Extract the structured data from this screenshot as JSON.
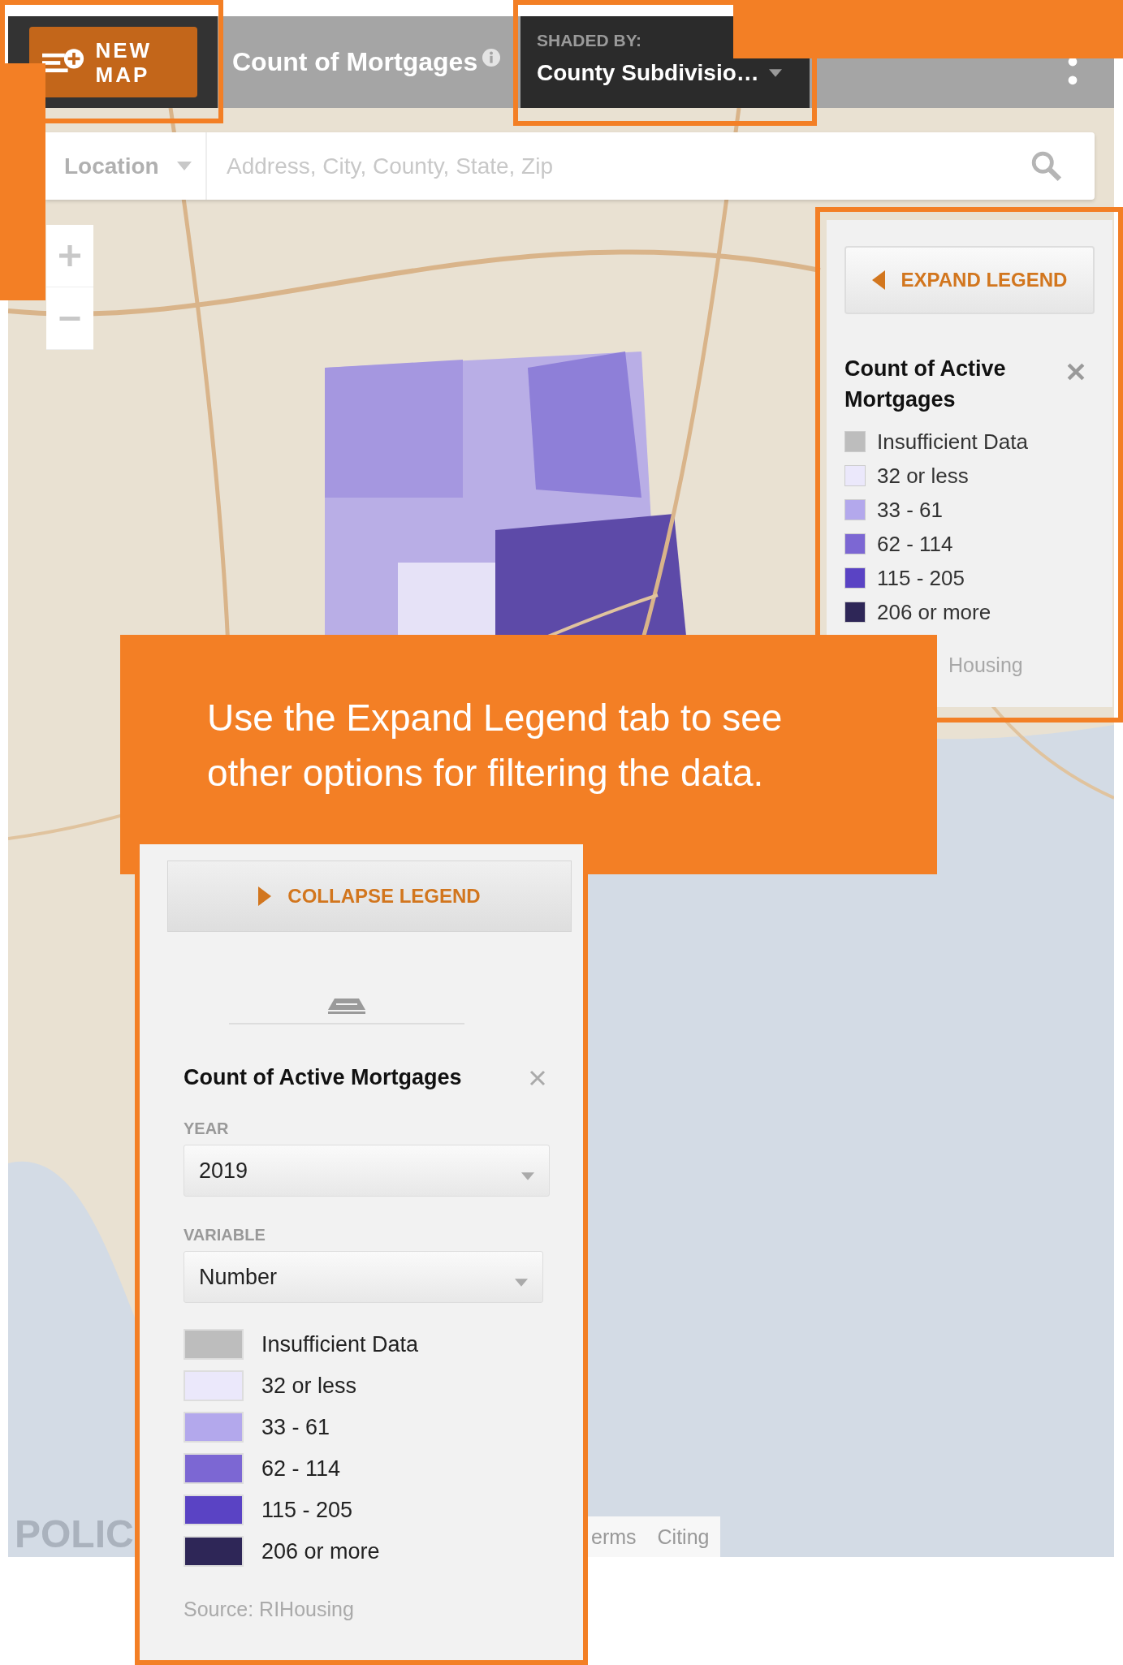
{
  "header": {
    "new_map_button": "NEW MAP",
    "map_title": "Count of Mortgages",
    "shaded_by": {
      "label": "SHADED BY:",
      "value": "County Subdivisio…"
    }
  },
  "search": {
    "location": "Location",
    "placeholder": "Address, City, County, State, Zip"
  },
  "legend_collapsed": {
    "expand_button": "EXPAND LEGEND",
    "title": "Count of Active Mortgages",
    "items": [
      {
        "label": "Insufficient Data",
        "color": "#bdbdbd"
      },
      {
        "label": "32 or less",
        "color": "#ebe8fb"
      },
      {
        "label": "33 - 61",
        "color": "#b3a8ec"
      },
      {
        "label": "62 - 114",
        "color": "#7c67d3"
      },
      {
        "label": "115 - 205",
        "color": "#5a43c4"
      },
      {
        "label": "206 or more",
        "color": "#2e2657"
      }
    ],
    "source": "Housing"
  },
  "callout": "Use the Expand Legend tab to see other options for filtering the data.",
  "legend_expanded": {
    "collapse_button": "COLLAPSE LEGEND",
    "title": "Count of Active Mortgages",
    "fields": [
      {
        "label": "YEAR",
        "value": "2019"
      },
      {
        "label": "VARIABLE",
        "value": "Number"
      }
    ],
    "items": [
      {
        "label": "Insufficient Data",
        "color": "#bdbdbd"
      },
      {
        "label": "32 or less",
        "color": "#ebe8fb"
      },
      {
        "label": "33 - 61",
        "color": "#b3a8ec"
      },
      {
        "label": "62 - 114",
        "color": "#7c67d3"
      },
      {
        "label": "115 - 205",
        "color": "#5a43c4"
      },
      {
        "label": "206 or more",
        "color": "#2e2657"
      }
    ],
    "source": "Source: RIHousing"
  },
  "map_footer": {
    "logo": "POLIC",
    "links": [
      "erms",
      "Citing"
    ]
  }
}
